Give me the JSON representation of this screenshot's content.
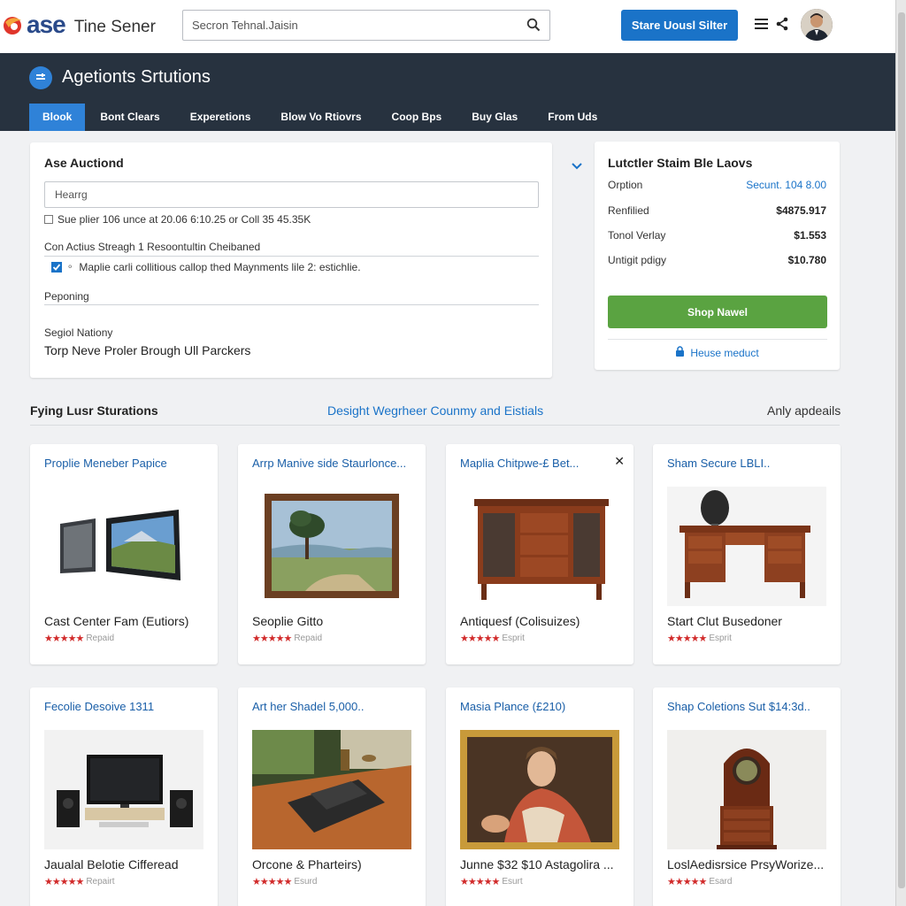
{
  "brand": {
    "logo_text": "ase",
    "subtitle": "Tine Sener"
  },
  "search": {
    "placeholder": "Secron Tehnal.Jaisin"
  },
  "header": {
    "share_label": "Stare Uousl Silter"
  },
  "section_header": {
    "title": "Agetionts Srtutions",
    "tabs": [
      "Blook",
      "Bont Clears",
      "Experetions",
      "Blow Vo Rtiovrs",
      "Coop Bps",
      "Buy Glas",
      "From Uds"
    ],
    "active_tab": 0
  },
  "left_panel": {
    "title": "Ase Auctiond",
    "input_placeholder": "Hearrg",
    "check1_label": "Sue plier 106 unce at 20.06 6:10.25 or Coll 35 45.35K",
    "label1": "Con Actius Streagh 1 Resoontultin Cheibaned",
    "check2_label": "Maplie carli collitious callop thed Maynments lile 2: estichlie.",
    "label2": "Peponing",
    "label3": "Segiol Nationy",
    "value3": "Torp Neve Proler Brough Ull Parckers"
  },
  "right_panel": {
    "title": "Lutctler Staim Ble Laovs",
    "rows": [
      {
        "key": "Orption",
        "value": "Secunt. 104 8.00"
      },
      {
        "key": "Renfilied",
        "value": "$4875.917"
      },
      {
        "key": "Tonol Verlay",
        "value": "$1.553"
      },
      {
        "key": "Untigit pdigy",
        "value": "$10.780"
      }
    ],
    "button_label": "Shop Nawel",
    "link_label": "Heuse meduct"
  },
  "listing": {
    "title": "Fying Lusr Sturations",
    "mid_link": "Desight Wegrheer Counmy and Eistials",
    "right_link": "Anly apdeails"
  },
  "cards": [
    {
      "title": "Proplie Meneber Papice",
      "name": "Cast Center Fam (Eutiors)",
      "rating_label": "Repaid",
      "image": "tv-icon"
    },
    {
      "title": "Arrp Manive side Staurlonce...",
      "name": "Seoplie Gitto",
      "rating_label": "Repaid",
      "image": "painting-landscape"
    },
    {
      "title": "Maplia Chitpwe-£ Bet...",
      "name": "Antiquesf (Colisuizes)",
      "rating_label": "Esprit",
      "image": "cabinet",
      "closable": true
    },
    {
      "title": "Sham Secure LBLI..",
      "name": "Start Clut Busedoner",
      "rating_label": "Esprit",
      "image": "desk"
    },
    {
      "title": "Fecolie Desoive 1311",
      "name": "Jaualal Belotie Cifferead",
      "rating_label": "Repairt",
      "image": "home-theater"
    },
    {
      "title": "Art her Shadel 5,000..",
      "name": "Orcone & Pharteirs)",
      "rating_label": "Esurd",
      "image": "typewriter"
    },
    {
      "title": "Masia Plance (£210)",
      "name": "Junne $32 $10 Astagolira ...",
      "rating_label": "Esurt",
      "image": "portrait"
    },
    {
      "title": "Shap Coletions Sut $14:3d..",
      "name": "LoslAedisrsice PrsyWorize...",
      "rating_label": "Esard",
      "image": "clock"
    }
  ],
  "colors": {
    "primary": "#1a73c8",
    "header_bg": "#27323f",
    "green": "#5aa341",
    "stars": "#d12b2b"
  }
}
